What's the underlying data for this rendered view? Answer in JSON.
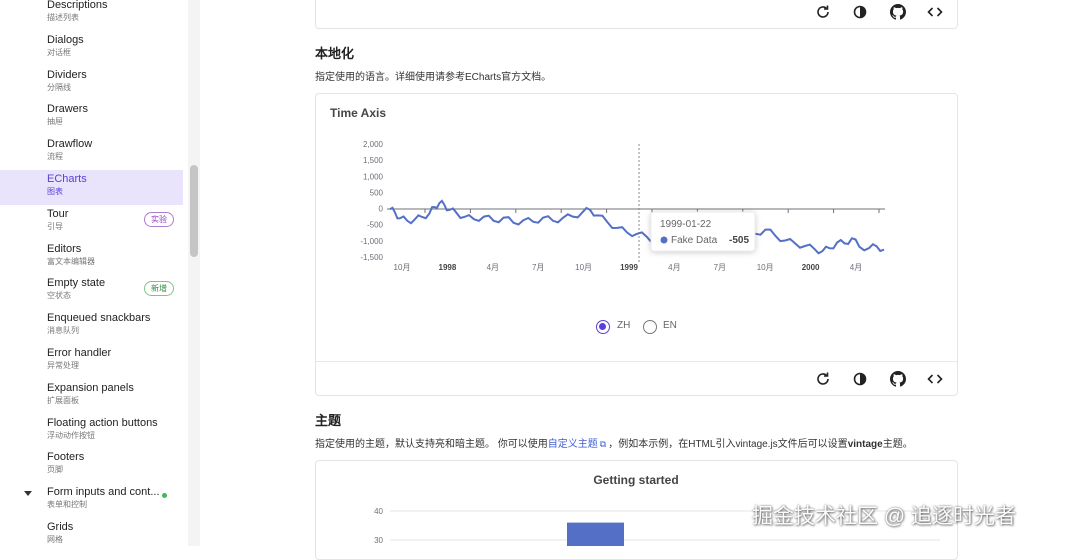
{
  "sidebar": {
    "items": [
      {
        "label": "Descriptions",
        "sublabel": "描述列表"
      },
      {
        "label": "Dialogs",
        "sublabel": "对话框"
      },
      {
        "label": "Dividers",
        "sublabel": "分隔线"
      },
      {
        "label": "Drawers",
        "sublabel": "抽屉"
      },
      {
        "label": "Drawflow",
        "sublabel": "流程"
      },
      {
        "label": "ECharts",
        "sublabel": "图表",
        "active": true
      },
      {
        "label": "Tour",
        "sublabel": "引导",
        "badge": "实验"
      },
      {
        "label": "Editors",
        "sublabel": "富文本编辑器"
      },
      {
        "label": "Empty state",
        "sublabel": "空状态",
        "badge": "新增"
      },
      {
        "label": "Enqueued snackbars",
        "sublabel": "消息队列"
      },
      {
        "label": "Error handler",
        "sublabel": "异常处理"
      },
      {
        "label": "Expansion panels",
        "sublabel": "扩展面板"
      },
      {
        "label": "Floating action buttons",
        "sublabel": "浮动动作按钮"
      },
      {
        "label": "Footers",
        "sublabel": "页脚"
      },
      {
        "label": "Form inputs and cont...",
        "sublabel": "表单和控制"
      },
      {
        "label": "Grids",
        "sublabel": "网格"
      }
    ]
  },
  "section_locale": {
    "title": "本地化",
    "desc": "指定使用的语言。详细使用请参考ECharts官方文档。"
  },
  "section_theme": {
    "title": "主题",
    "desc_pre": "指定使用的主题，默认支持亮和暗主题。 你可以使用",
    "link": "自定义主题",
    "desc_mid": "，例如本示例，在HTML引入vintage.js文件后可以设置",
    "desc_bold": "vintage",
    "desc_post": "主题。"
  },
  "locale_options": {
    "zh": "ZH",
    "en": "EN",
    "selected": "ZH"
  },
  "chart_data": [
    {
      "type": "line",
      "title": "Time Axis",
      "series": [
        {
          "name": "Fake Data"
        }
      ],
      "ylim": [
        -1500,
        2000
      ],
      "yticks": [
        "2,000",
        "1,500",
        "1,000",
        "500",
        "0",
        "-500",
        "-1,000",
        "-1,500"
      ],
      "xticks": [
        {
          "label": "10月",
          "bold": false
        },
        {
          "label": "1998",
          "bold": true
        },
        {
          "label": "4月",
          "bold": false
        },
        {
          "label": "7月",
          "bold": false
        },
        {
          "label": "10月",
          "bold": false
        },
        {
          "label": "1999",
          "bold": true
        },
        {
          "label": "4月",
          "bold": false
        },
        {
          "label": "7月",
          "bold": false
        },
        {
          "label": "10月",
          "bold": false
        },
        {
          "label": "2000",
          "bold": true
        },
        {
          "label": "4月",
          "bold": false
        }
      ],
      "tooltip": {
        "date": "1999-01-22",
        "series": "Fake Data",
        "value": "-505"
      },
      "points": [
        [
          0,
          -20
        ],
        [
          0.01,
          -120
        ],
        [
          0.02,
          -300
        ],
        [
          0.035,
          -380
        ],
        [
          0.05,
          -340
        ],
        [
          0.065,
          -260
        ],
        [
          0.08,
          -150
        ],
        [
          0.09,
          50
        ],
        [
          0.1,
          170
        ],
        [
          0.11,
          120
        ],
        [
          0.12,
          -40
        ],
        [
          0.135,
          -140
        ],
        [
          0.15,
          -260
        ],
        [
          0.17,
          -330
        ],
        [
          0.19,
          -250
        ],
        [
          0.21,
          -380
        ],
        [
          0.23,
          -280
        ],
        [
          0.25,
          -440
        ],
        [
          0.27,
          -360
        ],
        [
          0.29,
          -410
        ],
        [
          0.31,
          -280
        ],
        [
          0.33,
          -380
        ],
        [
          0.35,
          -290
        ],
        [
          0.37,
          -250
        ],
        [
          0.39,
          -110
        ],
        [
          0.405,
          -40
        ],
        [
          0.42,
          -210
        ],
        [
          0.44,
          -420
        ],
        [
          0.46,
          -600
        ],
        [
          0.48,
          -740
        ],
        [
          0.5,
          -780
        ],
        [
          0.52,
          -880
        ],
        [
          0.535,
          -960
        ],
        [
          0.55,
          -800
        ],
        [
          0.565,
          -480
        ],
        [
          0.58,
          -380
        ],
        [
          0.6,
          -505
        ],
        [
          0.62,
          -520
        ],
        [
          0.64,
          -560
        ],
        [
          0.66,
          -530
        ],
        [
          0.68,
          -600
        ],
        [
          0.7,
          -650
        ],
        [
          0.72,
          -720
        ],
        [
          0.74,
          -780
        ],
        [
          0.76,
          -650
        ],
        [
          0.78,
          -840
        ],
        [
          0.8,
          -990
        ],
        [
          0.82,
          -1080
        ],
        [
          0.84,
          -1160
        ],
        [
          0.86,
          -1260
        ],
        [
          0.875,
          -1320
        ],
        [
          0.89,
          -1230
        ],
        [
          0.905,
          -1050
        ],
        [
          0.92,
          -1080
        ],
        [
          0.935,
          -920
        ],
        [
          0.95,
          -1180
        ],
        [
          0.97,
          -1220
        ],
        [
          0.985,
          -1170
        ],
        [
          1.0,
          -1270
        ]
      ]
    },
    {
      "type": "bar",
      "title": "Getting started",
      "yticks": [
        "40",
        "30"
      ],
      "values": [
        36
      ]
    }
  ],
  "watermark": "掘金技术社区 @ 追逐时光者"
}
